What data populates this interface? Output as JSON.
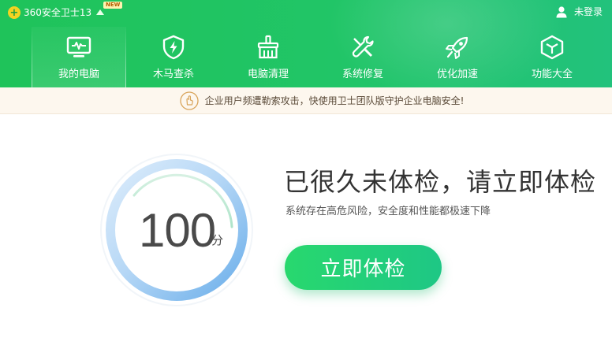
{
  "header": {
    "app_name": "360安全卫士13",
    "new_badge": "NEW",
    "login_label": "未登录"
  },
  "nav": {
    "items": [
      {
        "label": "我的电脑",
        "icon": "monitor-icon",
        "active": true
      },
      {
        "label": "木马查杀",
        "icon": "shield-bolt-icon",
        "active": false
      },
      {
        "label": "电脑清理",
        "icon": "broom-icon",
        "active": false
      },
      {
        "label": "系统修复",
        "icon": "wrench-screwdriver-icon",
        "active": false
      },
      {
        "label": "优化加速",
        "icon": "rocket-icon",
        "active": false
      },
      {
        "label": "功能大全",
        "icon": "cube-icon",
        "active": false
      }
    ]
  },
  "notice": {
    "icon": "hand-icon",
    "text": "企业用户频遭勒索攻击，快使用卫士团队版守护企业电脑安全!"
  },
  "main": {
    "score": "100",
    "score_unit": "分",
    "headline": "已很久未体检，请立即体检",
    "subline": "系统存在高危风险，安全度和性能都极速下降",
    "check_button": "立即体检"
  },
  "colors": {
    "header_green": "#21c35f",
    "button_green": "#22cf78",
    "ring_blue": "#76b8f0",
    "notice_bg": "#fdf7ee"
  }
}
